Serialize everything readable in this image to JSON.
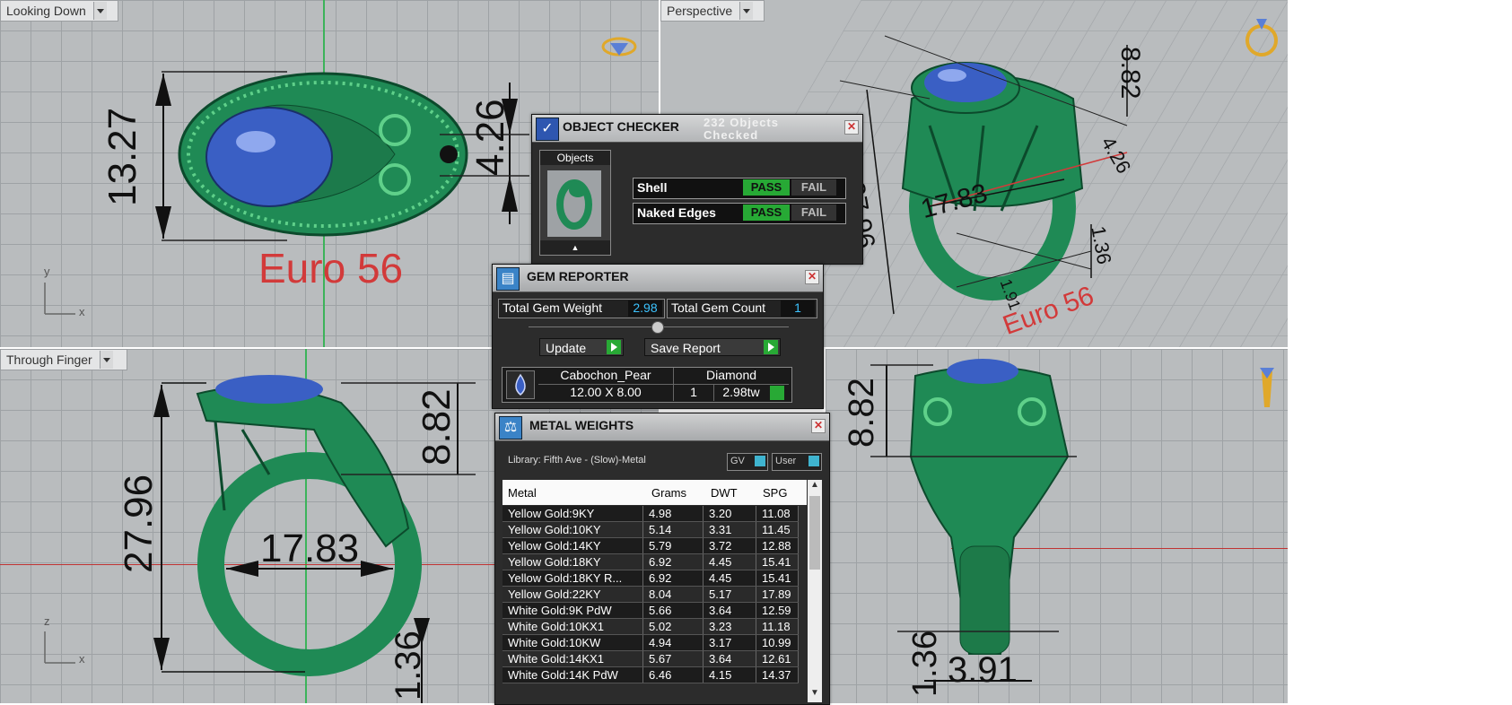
{
  "viewports": {
    "top": {
      "label": "Looking Down",
      "axis_x": "x",
      "axis_y": "y",
      "dims": [
        "13.27",
        "4.26"
      ],
      "size_text": "Euro 56"
    },
    "perspective": {
      "label": "Perspective",
      "dims": [
        "8.82",
        "27.96",
        "17.83",
        "4.26",
        "1.36",
        "1.91"
      ],
      "size_text": "Euro 56"
    },
    "front": {
      "label": "Through Finger",
      "axis_x": "x",
      "axis_y": "z",
      "dims": [
        "27.96",
        "8.82",
        "17.83",
        "1.36"
      ]
    },
    "right": {
      "dims": [
        "8.82",
        "1.36",
        "3.91"
      ]
    }
  },
  "object_checker": {
    "title": "OBJECT CHECKER",
    "summary": "232  Objects Checked",
    "objects_label": "Objects",
    "checks": [
      {
        "label": "Shell",
        "pass": "PASS",
        "fail": "FAIL"
      },
      {
        "label": "Naked Edges",
        "pass": "PASS",
        "fail": "FAIL"
      }
    ]
  },
  "gem_reporter": {
    "title": "GEM REPORTER",
    "total_weight_label": "Total Gem Weight",
    "total_weight_value": "2.98",
    "total_count_label": "Total Gem Count",
    "total_count_value": "1",
    "update_label": "Update",
    "save_label": "Save Report",
    "gem": {
      "shape": "Cabochon_Pear",
      "material": "Diamond",
      "size": "12.00 X 8.00",
      "count": "1",
      "weight": "2.98tw"
    }
  },
  "metal_weights": {
    "title": "METAL WEIGHTS",
    "library": "Library: Fifth Ave - (Slow)-Metal",
    "gv_label": "GV",
    "user_label": "User",
    "columns": [
      "Metal",
      "Grams",
      "DWT",
      "SPG"
    ],
    "rows": [
      [
        "Yellow Gold:9KY",
        "4.98",
        "3.20",
        "11.08"
      ],
      [
        "Yellow Gold:10KY",
        "5.14",
        "3.31",
        "11.45"
      ],
      [
        "Yellow Gold:14KY",
        "5.79",
        "3.72",
        "12.88"
      ],
      [
        "Yellow Gold:18KY",
        "6.92",
        "4.45",
        "15.41"
      ],
      [
        "Yellow Gold:18KY R...",
        "6.92",
        "4.45",
        "15.41"
      ],
      [
        "Yellow Gold:22KY",
        "8.04",
        "5.17",
        "17.89"
      ],
      [
        "White Gold:9K PdW",
        "5.66",
        "3.64",
        "12.59"
      ],
      [
        "White Gold:10KX1",
        "5.02",
        "3.23",
        "11.18"
      ],
      [
        "White Gold:10KW",
        "4.94",
        "3.17",
        "10.99"
      ],
      [
        "White Gold:14KX1",
        "5.67",
        "3.64",
        "12.61"
      ],
      [
        "White Gold:14K PdW",
        "6.46",
        "4.15",
        "14.37"
      ]
    ]
  },
  "colors": {
    "ring_green": "#1f8a55",
    "gem_blue": "#3a5fc4",
    "pass_green": "#27a935",
    "size_red": "#d23a3a"
  }
}
